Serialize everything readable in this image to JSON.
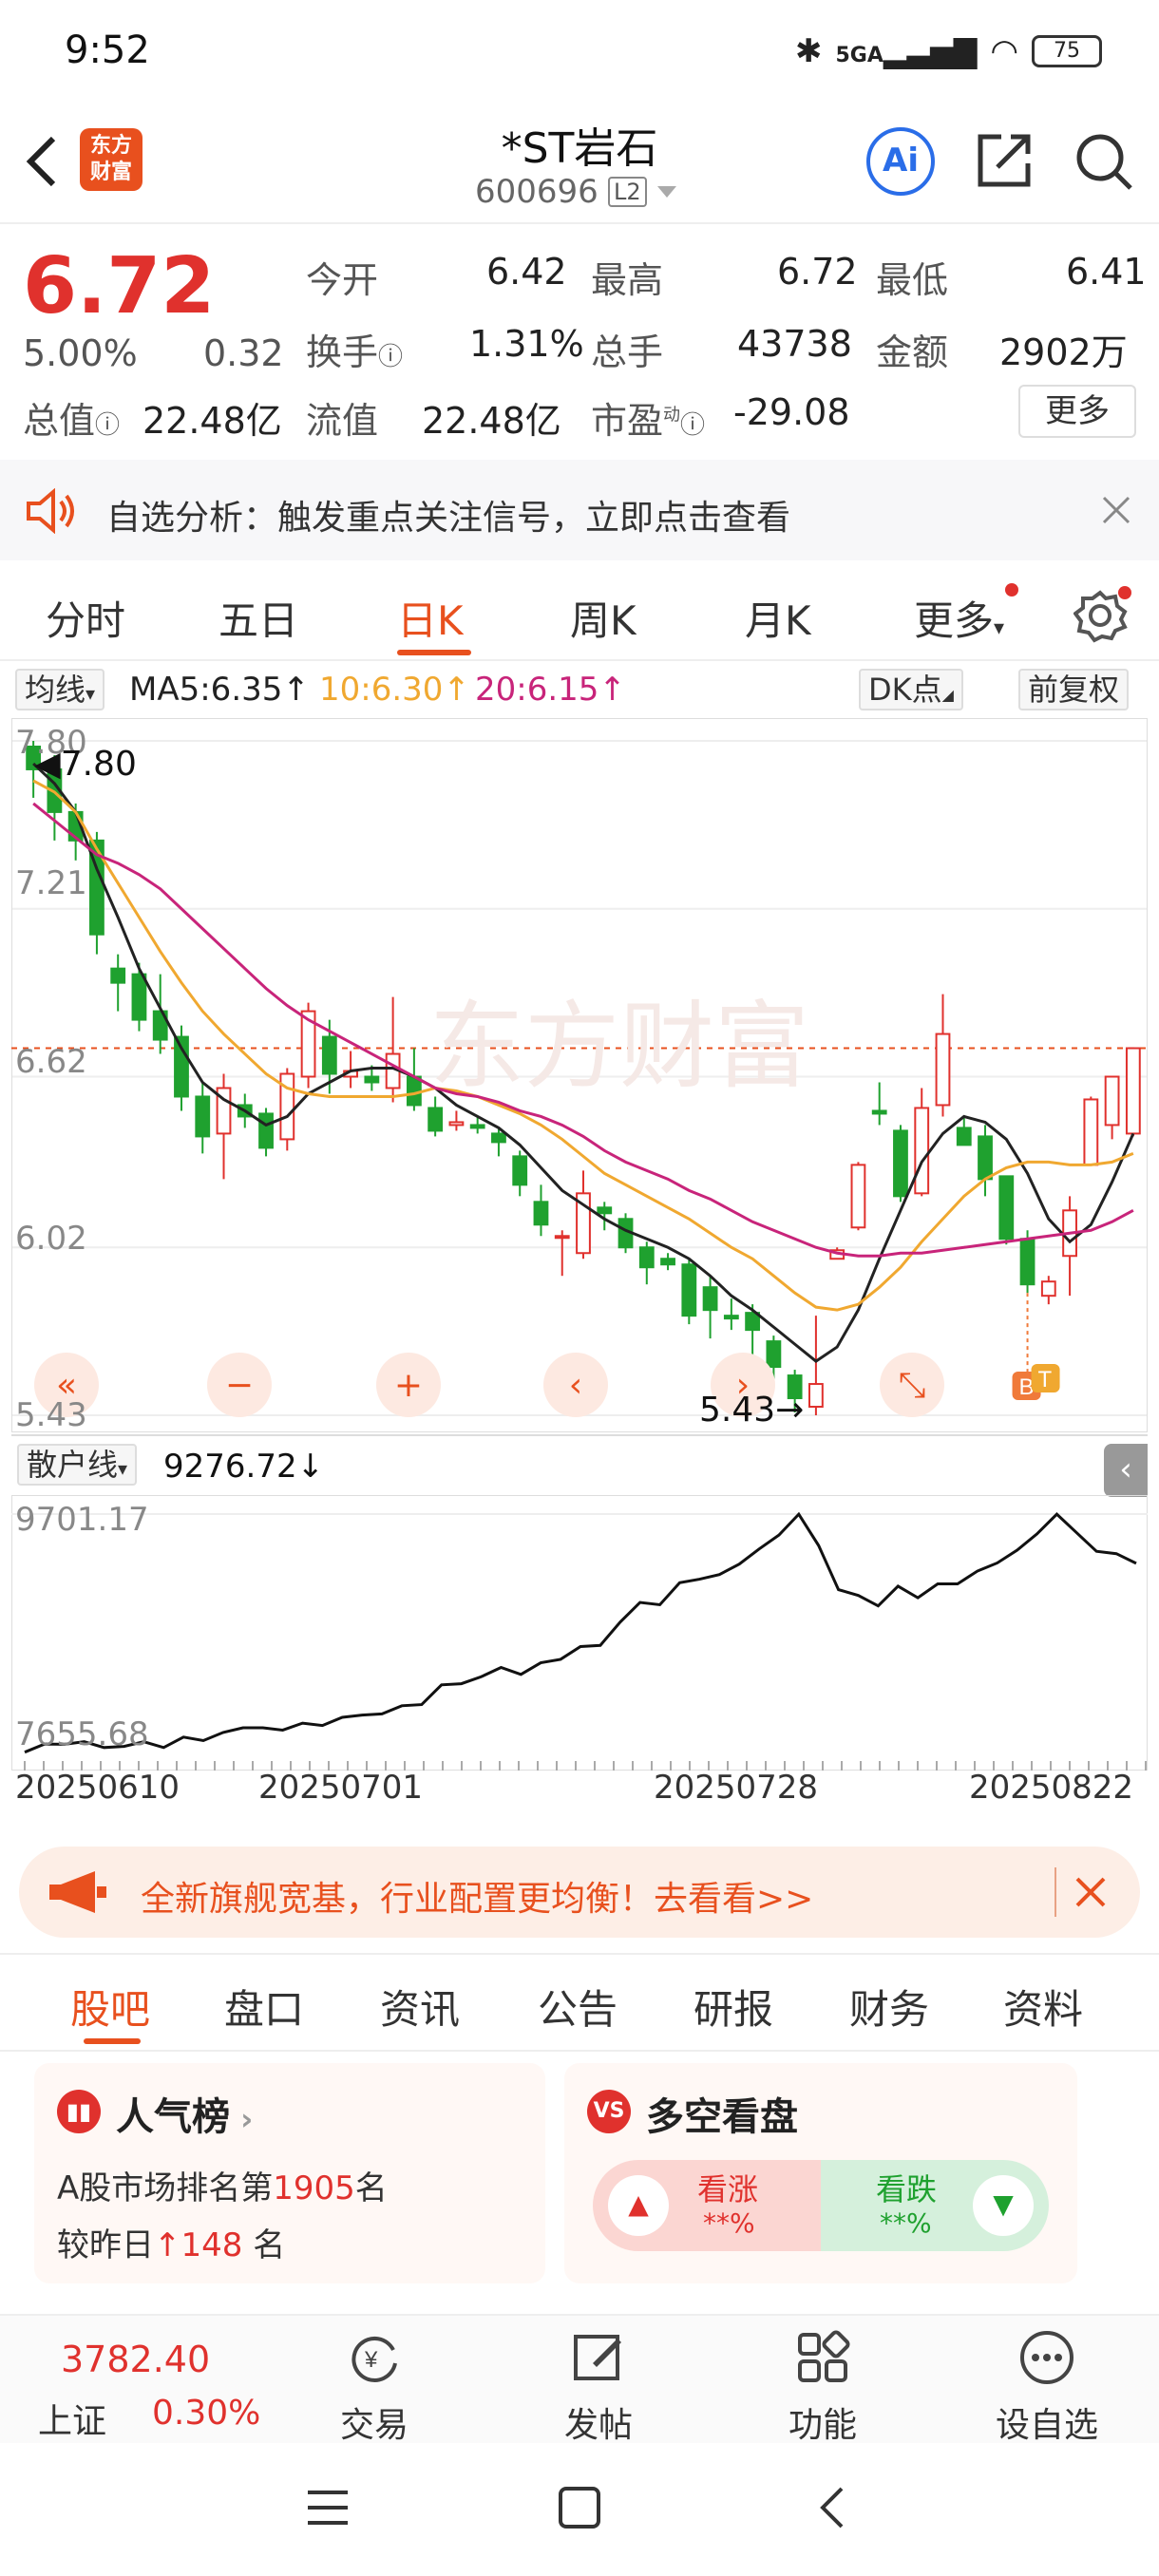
{
  "status": {
    "time": "9:52",
    "battery": "75",
    "signal": "5GA"
  },
  "header": {
    "logo_line1": "东方",
    "logo_line2": "财富",
    "stock_name": "*ST岩石",
    "stock_code": "600696",
    "level": "L2",
    "ai_label": "Ai"
  },
  "quote": {
    "price": "6.72",
    "change_pct": "5.00%",
    "change": "0.32",
    "open_label": "今开",
    "open": "6.42",
    "high_label": "最高",
    "high": "6.72",
    "low_label": "最低",
    "low": "6.41",
    "turnover_label": "换手",
    "turnover": "1.31%",
    "volume_label": "总手",
    "volume": "43738",
    "amount_label": "金额",
    "amount": "2902万",
    "mktcap_label": "总值",
    "mktcap": "22.48亿",
    "float_label": "流值",
    "float": "22.48亿",
    "pe_label": "市盈",
    "pe_sup": "动",
    "pe": "-29.08",
    "more": "更多"
  },
  "notice": {
    "text": "自选分析：触发重点关注信号，立即点击查看"
  },
  "tabs": [
    "分时",
    "五日",
    "日K",
    "周K",
    "月K",
    "更多"
  ],
  "active_tab": "日K",
  "ma_bar": {
    "selector": "均线",
    "ma5": "MA5:6.35",
    "ma10": "10:6.30",
    "ma20": "20:6.15",
    "dk": "DK点",
    "adjust": "前复权"
  },
  "colors": {
    "up": "#e0312d",
    "down": "#1fa12f",
    "ma5": "#222222",
    "ma10": "#f0a830",
    "ma20": "#c8247a",
    "accent": "#e8501e"
  },
  "chart_data": [
    {
      "type": "candlestick",
      "y_ticks": [
        "7.80",
        "7.21",
        "6.62",
        "6.02",
        "5.43"
      ],
      "ylim": [
        5.43,
        7.8
      ],
      "max_label": "7.80",
      "min_label": "5.43",
      "markers": [
        "B",
        "T"
      ],
      "candles": [
        [
          7.78,
          7.7,
          7.8,
          7.6
        ],
        [
          7.7,
          7.55,
          7.75,
          7.45
        ],
        [
          7.55,
          7.45,
          7.58,
          7.38
        ],
        [
          7.45,
          7.12,
          7.48,
          7.05
        ],
        [
          7.0,
          6.95,
          7.05,
          6.85
        ],
        [
          6.98,
          6.82,
          7.02,
          6.78
        ],
        [
          6.85,
          6.75,
          6.98,
          6.7
        ],
        [
          6.76,
          6.55,
          6.8,
          6.5
        ],
        [
          6.55,
          6.41,
          6.6,
          6.35
        ],
        [
          6.42,
          6.58,
          6.63,
          6.26
        ],
        [
          6.52,
          6.48,
          6.56,
          6.44
        ],
        [
          6.49,
          6.37,
          6.51,
          6.34
        ],
        [
          6.4,
          6.63,
          6.65,
          6.36
        ],
        [
          6.62,
          6.85,
          6.88,
          6.58
        ],
        [
          6.76,
          6.63,
          6.82,
          6.56
        ],
        [
          6.62,
          6.64,
          6.71,
          6.58
        ],
        [
          6.62,
          6.6,
          6.66,
          6.57
        ],
        [
          6.58,
          6.7,
          6.9,
          6.53
        ],
        [
          6.62,
          6.52,
          6.72,
          6.5
        ],
        [
          6.51,
          6.43,
          6.55,
          6.41
        ],
        [
          6.45,
          6.46,
          6.5,
          6.43
        ],
        [
          6.45,
          6.44,
          6.48,
          6.42
        ],
        [
          6.42,
          6.39,
          6.44,
          6.34
        ],
        [
          6.34,
          6.24,
          6.36,
          6.2
        ],
        [
          6.18,
          6.1,
          6.24,
          6.06
        ],
        [
          6.06,
          6.06,
          6.08,
          5.92
        ],
        [
          6.0,
          6.21,
          6.29,
          5.98
        ],
        [
          6.16,
          6.14,
          6.18,
          6.08
        ],
        [
          6.12,
          6.02,
          6.14,
          6.0
        ],
        [
          6.02,
          5.95,
          6.04,
          5.89
        ],
        [
          5.98,
          5.96,
          6.0,
          5.94
        ],
        [
          5.96,
          5.78,
          5.98,
          5.75
        ],
        [
          5.88,
          5.8,
          5.92,
          5.7
        ],
        [
          5.78,
          5.77,
          5.84,
          5.73
        ],
        [
          5.79,
          5.73,
          5.82,
          5.59
        ],
        [
          5.69,
          5.6,
          5.71,
          5.55
        ],
        [
          5.57,
          5.49,
          5.59,
          5.44
        ],
        [
          5.46,
          5.54,
          5.78,
          5.43
        ],
        [
          5.98,
          6.01,
          6.02,
          5.98
        ],
        [
          6.09,
          6.31,
          6.32,
          6.08
        ],
        [
          6.5,
          6.49,
          6.6,
          6.45
        ],
        [
          6.43,
          6.2,
          6.45,
          6.18
        ],
        [
          6.21,
          6.51,
          6.58,
          6.2
        ],
        [
          6.52,
          6.77,
          6.91,
          6.48
        ],
        [
          6.44,
          6.38,
          6.48,
          6.4
        ],
        [
          6.41,
          6.26,
          6.45,
          6.2
        ],
        [
          6.27,
          6.05,
          6.27,
          6.03
        ],
        [
          6.05,
          5.89,
          6.08,
          5.86
        ],
        [
          5.85,
          5.9,
          5.92,
          5.82
        ],
        [
          5.99,
          6.15,
          6.2,
          5.85
        ],
        [
          6.31,
          6.54,
          6.55,
          6.31
        ],
        [
          6.45,
          6.62,
          6.62,
          6.4
        ],
        [
          6.42,
          6.72,
          6.72,
          6.41
        ]
      ],
      "ma5": [
        7.72,
        7.65,
        7.55,
        7.35,
        7.18,
        7.0,
        6.86,
        6.72,
        6.6,
        6.54,
        6.5,
        6.45,
        6.48,
        6.56,
        6.6,
        6.64,
        6.65,
        6.65,
        6.62,
        6.58,
        6.52,
        6.48,
        6.44,
        6.38,
        6.3,
        6.22,
        6.17,
        6.12,
        6.08,
        6.05,
        6.02,
        5.98,
        5.92,
        5.85,
        5.8,
        5.74,
        5.68,
        5.62,
        5.67,
        5.8,
        5.98,
        6.15,
        6.32,
        6.42,
        6.48,
        6.46,
        6.4,
        6.28,
        6.12,
        6.04,
        6.1,
        6.25,
        6.42
      ],
      "ma10": [
        7.66,
        7.62,
        7.55,
        7.42,
        7.3,
        7.18,
        7.06,
        6.95,
        6.85,
        6.77,
        6.7,
        6.63,
        6.58,
        6.56,
        6.55,
        6.55,
        6.55,
        6.55,
        6.56,
        6.58,
        6.57,
        6.55,
        6.52,
        6.49,
        6.45,
        6.4,
        6.34,
        6.28,
        6.24,
        6.2,
        6.16,
        6.12,
        6.07,
        6.02,
        5.98,
        5.92,
        5.86,
        5.81,
        5.8,
        5.82,
        5.88,
        5.95,
        6.04,
        6.12,
        6.2,
        6.26,
        6.3,
        6.32,
        6.32,
        6.31,
        6.31,
        6.32,
        6.35
      ],
      "ma20": [
        7.58,
        7.52,
        7.46,
        7.4,
        7.37,
        7.33,
        7.28,
        7.21,
        7.14,
        7.07,
        7.0,
        6.93,
        6.87,
        6.82,
        6.78,
        6.74,
        6.7,
        6.66,
        6.62,
        6.58,
        6.56,
        6.55,
        6.53,
        6.5,
        6.48,
        6.45,
        6.41,
        6.36,
        6.32,
        6.29,
        6.26,
        6.22,
        6.19,
        6.15,
        6.11,
        6.08,
        6.05,
        6.02,
        6.0,
        5.99,
        5.99,
        6.0,
        6.0,
        6.01,
        6.02,
        6.03,
        6.04,
        6.05,
        6.06,
        6.07,
        6.08,
        6.11,
        6.15
      ]
    },
    {
      "type": "line",
      "name": "散户线",
      "current": "9276.72",
      "y_ticks": [
        "9701.17",
        "7655.68"
      ],
      "ylim": [
        7655.68,
        9701.17
      ],
      "x_ticks": [
        "20250610",
        "20250701",
        "20250728",
        "20250822"
      ],
      "values": [
        7650,
        7720,
        7718,
        7740,
        7690,
        7700,
        7740,
        7690,
        7780,
        7750,
        7820,
        7860,
        7860,
        7840,
        7900,
        7880,
        7950,
        7970,
        7980,
        8050,
        8060,
        8230,
        8240,
        8300,
        8380,
        8320,
        8420,
        8450,
        8560,
        8570,
        8770,
        8940,
        8920,
        9110,
        9140,
        9180,
        9270,
        9400,
        9520,
        9700,
        9430,
        9050,
        9000,
        8910,
        9080,
        8980,
        9100,
        9100,
        9210,
        9280,
        9390,
        9530,
        9700,
        9540,
        9380,
        9360,
        9276.72
      ]
    }
  ],
  "banner": {
    "text": "全新旗舰宽基，行业配置更均衡！去看看>>"
  },
  "bottom_tabs": [
    "股吧",
    "盘口",
    "资讯",
    "公告",
    "研报",
    "财务",
    "资料"
  ],
  "active_bottom_tab": "股吧",
  "popularity": {
    "title": "人气榜",
    "line1_prefix": "A股市场排名第",
    "rank": "1905",
    "line1_suffix": "名",
    "line2_prefix": "较昨日",
    "delta": "148",
    "line2_suffix": "名"
  },
  "sentiment": {
    "title": "多空看盘",
    "up_label": "看涨",
    "up_value": "**%",
    "down_label": "看跌",
    "down_value": "**%"
  },
  "bottom_bar": {
    "index_value": "3782.40",
    "index_name": "上证",
    "index_change": "0.30%",
    "items": [
      "交易",
      "发帖",
      "功能",
      "设自选"
    ]
  }
}
